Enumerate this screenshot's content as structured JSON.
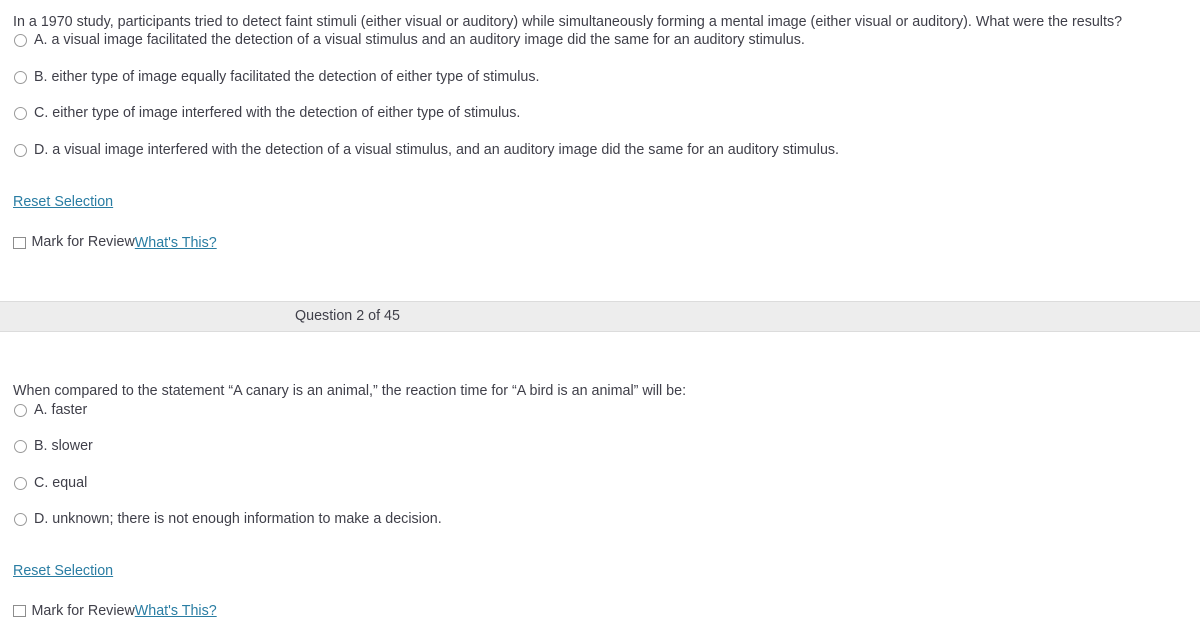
{
  "questions": [
    {
      "stem": "In a 1970 study, participants tried to detect faint stimuli (either visual or auditory) while simultaneously forming a mental image (either visual or auditory). What were the results?",
      "options": [
        "A. a visual image facilitated the detection of a visual stimulus and an auditory image did the same for an auditory stimulus.",
        "B. either type of image equally facilitated the detection of either type of stimulus.",
        "C. either type of image interfered with the detection of either type of stimulus.",
        "D. a visual image interfered with the detection of a visual stimulus, and an auditory image did the same for an auditory stimulus."
      ],
      "reset_label": "Reset Selection",
      "mark_for_review_label": "Mark for Review",
      "whats_this_label": "What's This?"
    },
    {
      "stem": "When compared to the statement “A canary is an animal,” the reaction time for “A bird is an animal” will be:",
      "options": [
        "A. faster",
        "B. slower",
        "C. equal",
        "D. unknown; there is not enough information to make a decision."
      ],
      "reset_label": "Reset Selection",
      "mark_for_review_label": "Mark for Review",
      "whats_this_label": "What's This?"
    }
  ],
  "divider": {
    "label": "Question 2 of 45"
  },
  "colors": {
    "link": "#2a7da3",
    "text": "#3f3f49",
    "divider_bg": "#ededed",
    "divider_border": "#dcdcdc",
    "control_border": "#9a9a9a"
  }
}
